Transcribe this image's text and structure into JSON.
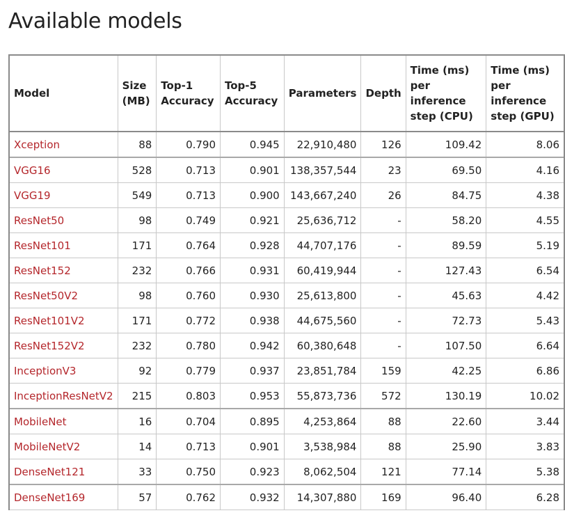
{
  "page": {
    "title": "Available models"
  },
  "table": {
    "headers": {
      "model": "Model",
      "size": "Size (MB)",
      "top1": "Top-1 Accuracy",
      "top5": "Top-5 Accuracy",
      "parameters": "Parameters",
      "depth": "Depth",
      "cpu": "Time (ms) per inference step (CPU)",
      "gpu": "Time (ms) per inference step (GPU)"
    },
    "header_lines": {
      "size": [
        "Size",
        "(MB)"
      ],
      "top1": [
        "Top-1",
        "Accuracy"
      ],
      "top5": [
        "Top-5",
        "Accuracy"
      ],
      "cpu": [
        "Time (ms)",
        "per",
        "inference",
        "step (CPU)"
      ],
      "gpu": [
        "Time (ms)",
        "per",
        "inference",
        "step (GPU)"
      ]
    },
    "rows": [
      {
        "model": "Xception",
        "size": "88",
        "top1": "0.790",
        "top5": "0.945",
        "parameters": "22,910,480",
        "depth": "126",
        "cpu": "109.42",
        "gpu": "8.06"
      },
      {
        "model": "VGG16",
        "size": "528",
        "top1": "0.713",
        "top5": "0.901",
        "parameters": "138,357,544",
        "depth": "23",
        "cpu": "69.50",
        "gpu": "4.16"
      },
      {
        "model": "VGG19",
        "size": "549",
        "top1": "0.713",
        "top5": "0.900",
        "parameters": "143,667,240",
        "depth": "26",
        "cpu": "84.75",
        "gpu": "4.38"
      },
      {
        "model": "ResNet50",
        "size": "98",
        "top1": "0.749",
        "top5": "0.921",
        "parameters": "25,636,712",
        "depth": "-",
        "cpu": "58.20",
        "gpu": "4.55"
      },
      {
        "model": "ResNet101",
        "size": "171",
        "top1": "0.764",
        "top5": "0.928",
        "parameters": "44,707,176",
        "depth": "-",
        "cpu": "89.59",
        "gpu": "5.19"
      },
      {
        "model": "ResNet152",
        "size": "232",
        "top1": "0.766",
        "top5": "0.931",
        "parameters": "60,419,944",
        "depth": "-",
        "cpu": "127.43",
        "gpu": "6.54"
      },
      {
        "model": "ResNet50V2",
        "size": "98",
        "top1": "0.760",
        "top5": "0.930",
        "parameters": "25,613,800",
        "depth": "-",
        "cpu": "45.63",
        "gpu": "4.42"
      },
      {
        "model": "ResNet101V2",
        "size": "171",
        "top1": "0.772",
        "top5": "0.938",
        "parameters": "44,675,560",
        "depth": "-",
        "cpu": "72.73",
        "gpu": "5.43"
      },
      {
        "model": "ResNet152V2",
        "size": "232",
        "top1": "0.780",
        "top5": "0.942",
        "parameters": "60,380,648",
        "depth": "-",
        "cpu": "107.50",
        "gpu": "6.64"
      },
      {
        "model": "InceptionV3",
        "size": "92",
        "top1": "0.779",
        "top5": "0.937",
        "parameters": "23,851,784",
        "depth": "159",
        "cpu": "42.25",
        "gpu": "6.86"
      },
      {
        "model": "InceptionResNetV2",
        "size": "215",
        "top1": "0.803",
        "top5": "0.953",
        "parameters": "55,873,736",
        "depth": "572",
        "cpu": "130.19",
        "gpu": "10.02"
      },
      {
        "model": "MobileNet",
        "size": "16",
        "top1": "0.704",
        "top5": "0.895",
        "parameters": "4,253,864",
        "depth": "88",
        "cpu": "22.60",
        "gpu": "3.44"
      },
      {
        "model": "MobileNetV2",
        "size": "14",
        "top1": "0.713",
        "top5": "0.901",
        "parameters": "3,538,984",
        "depth": "88",
        "cpu": "25.90",
        "gpu": "3.83"
      },
      {
        "model": "DenseNet121",
        "size": "33",
        "top1": "0.750",
        "top5": "0.923",
        "parameters": "8,062,504",
        "depth": "121",
        "cpu": "77.14",
        "gpu": "5.38"
      },
      {
        "model": "DenseNet169",
        "size": "57",
        "top1": "0.762",
        "top5": "0.932",
        "parameters": "14,307,880",
        "depth": "169",
        "cpu": "96.40",
        "gpu": "6.28"
      }
    ]
  },
  "colors": {
    "link": "#b4262b",
    "text": "#222222",
    "border": "#c8c8c8",
    "border_strong": "#8a8a8a"
  }
}
